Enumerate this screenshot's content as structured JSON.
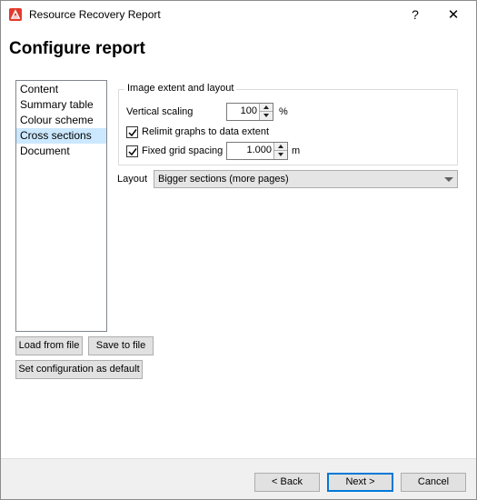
{
  "window": {
    "title": "Resource Recovery Report",
    "help_glyph": "?",
    "close_glyph": "✕"
  },
  "header": {
    "title": "Configure report"
  },
  "nav": {
    "items": [
      {
        "label": "Content",
        "selected": false
      },
      {
        "label": "Summary table",
        "selected": false
      },
      {
        "label": "Colour scheme",
        "selected": false
      },
      {
        "label": "Cross sections",
        "selected": true
      },
      {
        "label": "Document",
        "selected": false
      }
    ]
  },
  "image_extent": {
    "group_title": "Image extent and layout",
    "vertical_scaling_label": "Vertical scaling",
    "vertical_scaling_value": "100",
    "vertical_scaling_unit": "%",
    "relimit_label": "Relimit graphs to data extent",
    "relimit_checked": true,
    "fixed_grid_label": "Fixed grid spacing",
    "fixed_grid_checked": true,
    "fixed_grid_value": "1.000",
    "fixed_grid_unit": "m"
  },
  "layout": {
    "label": "Layout",
    "selected": "Bigger sections (more pages)"
  },
  "config_buttons": {
    "load": "Load from file",
    "save": "Save to file",
    "set_default": "Set configuration as default"
  },
  "footer": {
    "back": "< Back",
    "next": "Next >",
    "cancel": "Cancel"
  },
  "colors": {
    "selection": "#cce8ff",
    "default_button_border": "#0078d7",
    "app_icon": "#e23a2e"
  },
  "icons": {
    "app": "app-logo-icon",
    "check": "checkmark-icon",
    "spin_up": "spin-up-arrow-icon",
    "spin_down": "spin-down-arrow-icon",
    "dropdown": "chevron-down-icon"
  }
}
